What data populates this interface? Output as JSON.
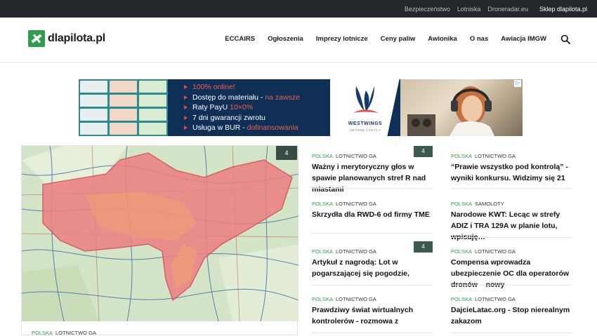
{
  "topbar": {
    "links": [
      "Bezpieczeństwo",
      "Lotniska",
      "Droneradar.eu"
    ],
    "shop": "Sklep dlapilota.pl"
  },
  "header": {
    "logo": "dlapilota.pl",
    "nav": [
      "ECCAIRS",
      "Ogłoszenia",
      "Imprezy lotnicze",
      "Ceny paliw",
      "Awionika",
      "O nas",
      "Awiacja IMGW"
    ]
  },
  "ad": {
    "lines": [
      {
        "text": "100% online!",
        "accent": "",
        "red_all": true
      },
      {
        "text": "Dostęp do materiału - ",
        "accent": "na zawsze",
        "red_all": false
      },
      {
        "text": "Raty PayU ",
        "accent": "10×0%",
        "red_all": false
      },
      {
        "text": "7 dni gwarancji zwrotu",
        "accent": "",
        "red_all": false
      },
      {
        "text": "Usługa w BUR - ",
        "accent": "dofinansowania",
        "red_all": false
      }
    ],
    "brand": "WESTWINGS",
    "tagline": "ANYONE CAN FLY"
  },
  "hero": {
    "count": "4",
    "category": "POLSKA",
    "subcategory": "LOTNICTWO GA"
  },
  "articles_mid": [
    {
      "category": "POLSKA",
      "subcategory": "LOTNICTWO GA",
      "title": "Ważny i merytoryczny głos w spawie planowanych stref R nad miastami",
      "badge": "4"
    },
    {
      "category": "POLSKA",
      "subcategory": "LOTNICTWO GA",
      "title": "Skrzydła dla RWD-6 od firmy TME",
      "badge": ""
    },
    {
      "category": "POLSKA",
      "subcategory": "LOTNICTWO GA",
      "title": "Artykuł z nagrodą: Lot w pogarszającej się pogodzie,",
      "badge": "4"
    },
    {
      "category": "POLSKA",
      "subcategory": "LOTNICTWO GA",
      "title": "Prawdziwy świat wirtualnych kontrolerów - rozmowa z",
      "badge": ""
    }
  ],
  "articles_right": [
    {
      "category": "POLSKA",
      "subcategory": "LOTNICTWO GA",
      "title": "“Prawie wszystko pod kontrolą” - wyniki konkursu. Widzimy się 21"
    },
    {
      "category": "POLSKA",
      "subcategory": "SAMOLOTY",
      "title": "Narodowe KWT: Lecąc w strefy ADIZ i TRA 129A w planie lotu, wpisuję…"
    },
    {
      "category": "POLSKA",
      "subcategory": "LOTNICTWO GA",
      "title": "Compensa wprowadza ubezpieczenie OC dla operatorów dronów – nowy"
    },
    {
      "category": "POLSKA",
      "subcategory": "LOTNICTWO GA",
      "title": "DajcieLatac.org - Stop nierealnym zakazom"
    }
  ],
  "colors": {
    "accent": "#2f9c4f",
    "badge": "#3b5a52",
    "topbar": "#23272b"
  }
}
